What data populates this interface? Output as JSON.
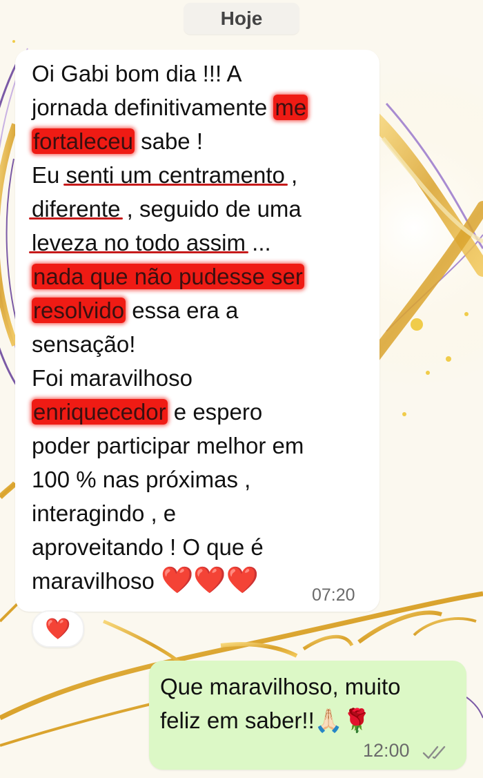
{
  "chat": {
    "date_label": "Hoje",
    "incoming": {
      "lines": [
        [
          "Oi Gabi bom dia !!! A"
        ],
        [
          "jornada definitivamente ",
          "me"
        ],
        [
          "fortaleceu",
          " sabe !"
        ],
        [
          "Eu ",
          "senti um centramento",
          " ,"
        ],
        [
          "diferente",
          " , seguido de uma"
        ],
        [
          "leveza no todo assim",
          " ..."
        ],
        [
          "nada que não pudesse ser"
        ],
        [
          "resolvido",
          " essa era a"
        ],
        [
          "sensação!"
        ],
        [
          "Foi maravilhoso"
        ],
        [
          "enriquecedor",
          " e espero"
        ],
        [
          "poder participar melhor em"
        ],
        [
          "100 % nas próximas ,"
        ],
        [
          "interagindo , e"
        ],
        [
          "aproveitando ! O que é"
        ],
        [
          "maravilhoso "
        ]
      ],
      "hearts": [
        "❤️",
        "❤️",
        "❤️"
      ],
      "time": "07:20",
      "reaction": "❤️"
    },
    "outgoing": {
      "lines": [
        "Que maravilhoso, muito",
        "feliz em saber!!🙏🏻🌹"
      ],
      "time": "12:00",
      "status_icon": "double-check-icon"
    }
  },
  "colors": {
    "highlight": "#ef1b14",
    "outgoing_bubble": "#dcf8c6",
    "incoming_bubble": "#ffffff",
    "wallpaper_gold": "#e8b83a"
  }
}
